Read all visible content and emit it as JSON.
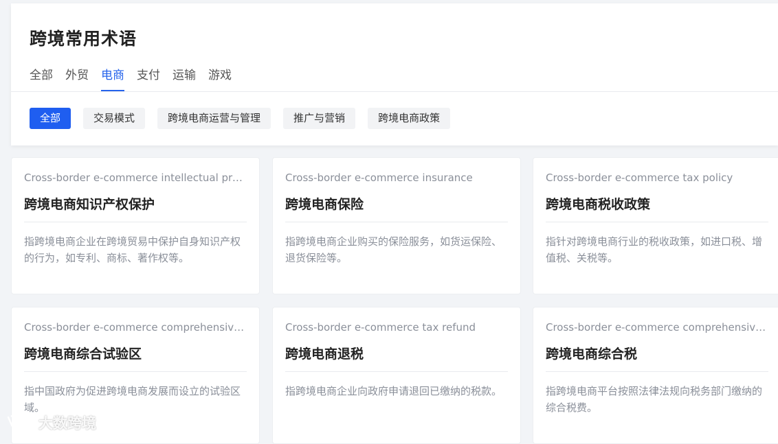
{
  "title": "跨境常用术语",
  "tabs": [
    {
      "label": "全部"
    },
    {
      "label": "外贸"
    },
    {
      "label": "电商"
    },
    {
      "label": "支付"
    },
    {
      "label": "运输"
    },
    {
      "label": "游戏"
    }
  ],
  "filters": [
    {
      "label": "全部"
    },
    {
      "label": "交易模式"
    },
    {
      "label": "跨境电商运营与管理"
    },
    {
      "label": "推广与营销"
    },
    {
      "label": "跨境电商政策"
    }
  ],
  "cards": [
    {
      "en": "Cross-border e-commerce intellectual prope...",
      "zh": "跨境电商知识产权保护",
      "desc": "指跨境电商企业在跨境贸易中保护自身知识产权的行为，如专利、商标、著作权等。"
    },
    {
      "en": "Cross-border e-commerce insurance",
      "zh": "跨境电商保险",
      "desc": "指跨境电商企业购买的保险服务，如货运保险、退货保险等。"
    },
    {
      "en": "Cross-border e-commerce tax policy",
      "zh": "跨境电商税收政策",
      "desc": "指针对跨境电商行业的税收政策，如进口税、增值税、关税等。"
    },
    {
      "en": "Cross-border e-commerce comprehensive te...",
      "zh": "跨境电商综合试验区",
      "desc": "指中国政府为促进跨境电商发展而设立的试验区域。"
    },
    {
      "en": "Cross-border e-commerce tax refund",
      "zh": "跨境电商退税",
      "desc": "指跨境电商企业向政府申请退回已缴纳的税款。"
    },
    {
      "en": "Cross-border e-commerce comprehensive tax",
      "zh": "跨境电商综合税",
      "desc": "指跨境电商平台按照法律法规向税务部门缴纳的综合税费。"
    }
  ],
  "watermark": {
    "text": "大数跨境",
    "icon": "brand-logo-icon"
  },
  "colors": {
    "accent": "#2563eb",
    "chip_active": "#1f5ef0"
  }
}
